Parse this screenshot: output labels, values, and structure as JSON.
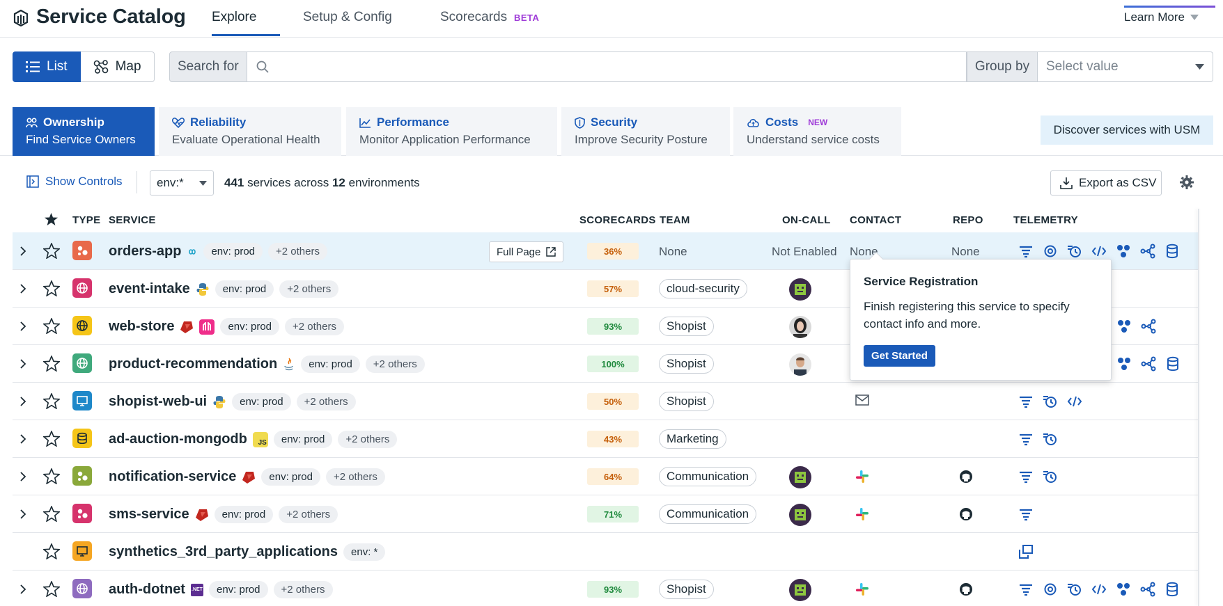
{
  "app": {
    "title": "Service Catalog",
    "tabs": [
      {
        "label": "Explore",
        "active": true
      },
      {
        "label": "Setup & Config",
        "active": false
      },
      {
        "label": "Scorecards",
        "active": false,
        "badge": "BETA"
      }
    ],
    "learn_more": "Learn More"
  },
  "toolbar": {
    "view_list": "List",
    "view_map": "Map",
    "search_label": "Search for",
    "search_value": "",
    "group_label": "Group by",
    "group_placeholder": "Select value"
  },
  "lenses": [
    {
      "title": "Ownership",
      "subtitle": "Find Service Owners",
      "active": true,
      "icon": "people-icon"
    },
    {
      "title": "Reliability",
      "subtitle": "Evaluate Operational Health",
      "active": false,
      "icon": "heartbeat-icon"
    },
    {
      "title": "Performance",
      "subtitle": "Monitor Application Performance",
      "active": false,
      "icon": "chart-line-icon"
    },
    {
      "title": "Security",
      "subtitle": "Improve Security Posture",
      "active": false,
      "icon": "shield-icon"
    },
    {
      "title": "Costs",
      "subtitle": "Understand service costs",
      "active": false,
      "badge": "NEW",
      "icon": "cloud-cost-icon"
    }
  ],
  "usm_button": "Discover services with USM",
  "controls": {
    "show_controls": "Show Controls",
    "env_value": "env:*",
    "summary_count": "441",
    "summary_mid": " services across ",
    "summary_envs": "12",
    "summary_end": " environments",
    "export": "Export as CSV"
  },
  "table": {
    "headers": {
      "type": "TYPE",
      "service": "SERVICE",
      "scorecards": "SCORECARDS",
      "team": "TEAM",
      "oncall": "ON-CALL",
      "contact": "CONTACT",
      "repo": "REPO",
      "telemetry": "TELEMETRY"
    },
    "full_page": "Full Page",
    "rows": [
      {
        "name": "orders-app",
        "env": "env: prod",
        "more": "+2 others",
        "score": "36%",
        "score_color": "orange",
        "team": "None",
        "oncall": "Not Enabled",
        "contact": "None",
        "repo": "None"
      },
      {
        "name": "event-intake",
        "env": "env: prod",
        "more": "+2 others",
        "score": "57%",
        "score_color": "orange",
        "team": "cloud-security"
      },
      {
        "name": "web-store",
        "env": "env: prod",
        "more": "+2 others",
        "score": "93%",
        "score_color": "green",
        "team": "Shopist"
      },
      {
        "name": "product-recommendation",
        "env": "env: prod",
        "more": "+2 others",
        "score": "100%",
        "score_color": "green",
        "team": "Shopist"
      },
      {
        "name": "shopist-web-ui",
        "env": "env: prod",
        "more": "+2 others",
        "score": "50%",
        "score_color": "orange",
        "team": "Shopist"
      },
      {
        "name": "ad-auction-mongodb",
        "env": "env: prod",
        "more": "+2 others",
        "score": "43%",
        "score_color": "orange",
        "team": "Marketing",
        "lang": "JS"
      },
      {
        "name": "notification-service",
        "env": "env: prod",
        "more": "+2 others",
        "score": "64%",
        "score_color": "orange",
        "team": "Communication"
      },
      {
        "name": "sms-service",
        "env": "env: prod",
        "more": "+2 others",
        "score": "71%",
        "score_color": "green",
        "team": "Communication"
      },
      {
        "name": "synthetics_3rd_party_applications",
        "env": "env: *"
      },
      {
        "name": "auth-dotnet",
        "env": "env: prod",
        "more": "+2 others",
        "score": "93%",
        "score_color": "green",
        "team": "Shopist",
        "lang": ".NET"
      }
    ]
  },
  "popover": {
    "title": "Service Registration",
    "body": "Finish registering this service to specify contact info and more.",
    "button": "Get Started"
  },
  "colors": {
    "primary": "#1a5ab8",
    "beta": "#9f3cd8",
    "score_orange_bg": "#fdf0db",
    "score_green_bg": "#e1f5e4"
  }
}
